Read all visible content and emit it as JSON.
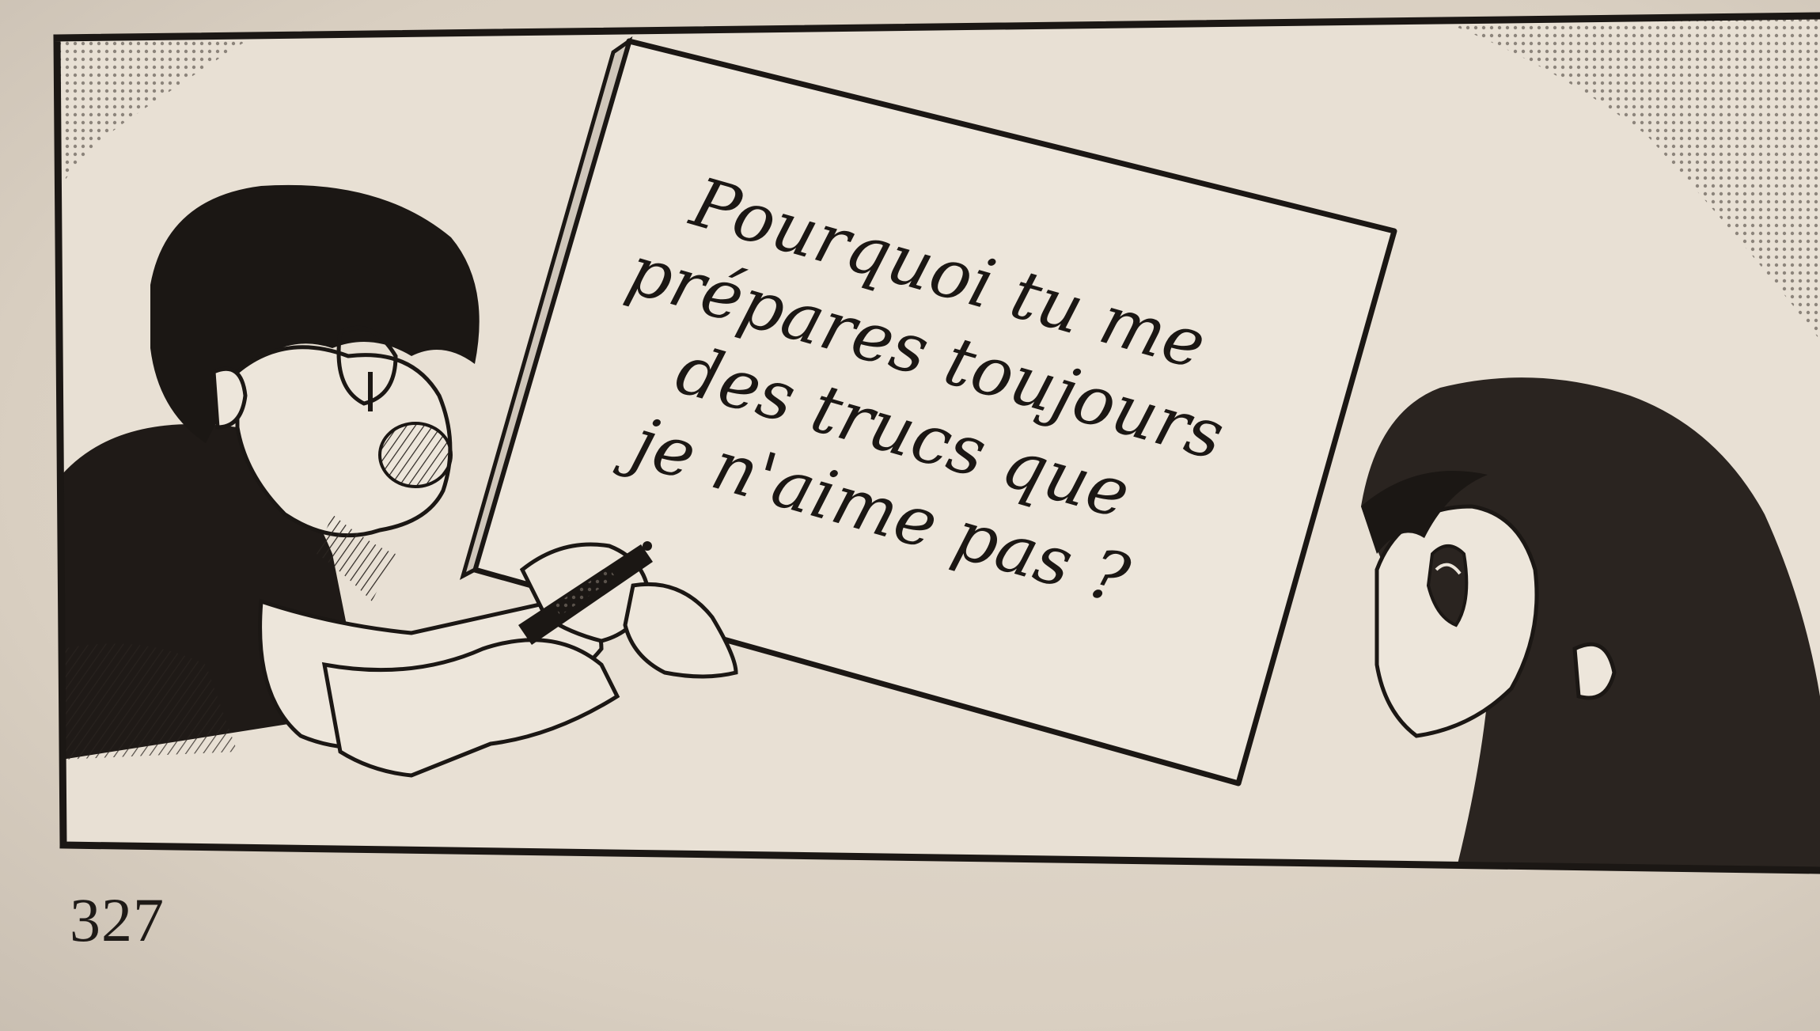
{
  "panel": {
    "sign_lines": [
      "Pourquoi tu me",
      "prépares toujours",
      "des trucs que",
      "je n'aime pas ?"
    ]
  },
  "page_number": "327",
  "colors": {
    "paper": "#ddd4c8",
    "ink": "#1b1714",
    "screentone": "#6f6760"
  },
  "icons": {
    "marker": "marker-pen-icon"
  }
}
